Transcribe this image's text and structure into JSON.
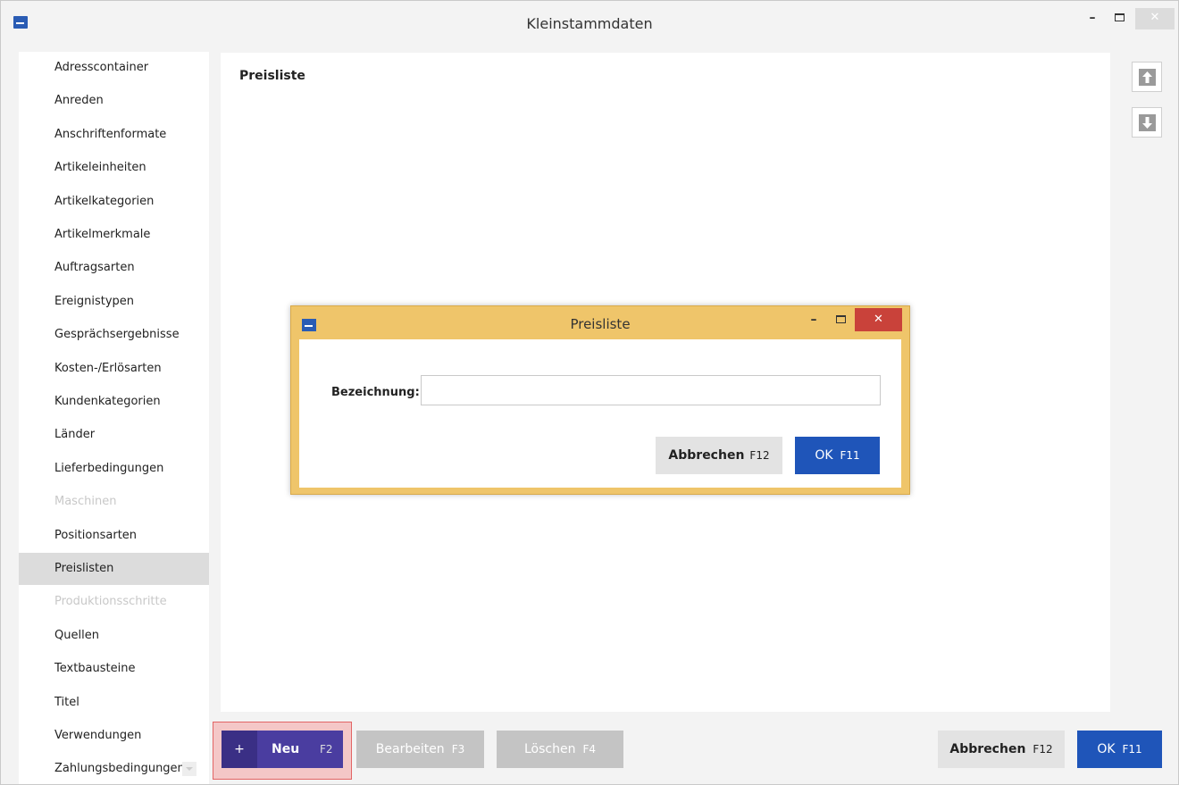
{
  "window": {
    "title": "Kleinstammdaten",
    "minimize": "–",
    "close": "✕"
  },
  "sidebar": {
    "items": [
      {
        "label": "Adresscontainer",
        "state": "normal"
      },
      {
        "label": "Anreden",
        "state": "normal"
      },
      {
        "label": "Anschriftenformate",
        "state": "normal"
      },
      {
        "label": "Artikeleinheiten",
        "state": "normal"
      },
      {
        "label": "Artikelkategorien",
        "state": "normal"
      },
      {
        "label": "Artikelmerkmale",
        "state": "normal"
      },
      {
        "label": "Auftragsarten",
        "state": "normal"
      },
      {
        "label": "Ereignistypen",
        "state": "normal"
      },
      {
        "label": "Gesprächsergebnisse",
        "state": "normal"
      },
      {
        "label": "Kosten-/Erlösarten",
        "state": "normal"
      },
      {
        "label": "Kundenkategorien",
        "state": "normal"
      },
      {
        "label": "Länder",
        "state": "normal"
      },
      {
        "label": "Lieferbedingungen",
        "state": "normal"
      },
      {
        "label": "Maschinen",
        "state": "disabled"
      },
      {
        "label": "Positionsarten",
        "state": "normal"
      },
      {
        "label": "Preislisten",
        "state": "selected"
      },
      {
        "label": "Produktionsschritte",
        "state": "disabled"
      },
      {
        "label": "Quellen",
        "state": "normal"
      },
      {
        "label": "Textbausteine",
        "state": "normal"
      },
      {
        "label": "Titel",
        "state": "normal"
      },
      {
        "label": "Verwendungen",
        "state": "normal"
      },
      {
        "label": "Zahlungsbedingungen",
        "state": "normal"
      }
    ]
  },
  "content": {
    "title": "Preisliste"
  },
  "toolbar": {
    "neu_plus": "+",
    "neu_label": "Neu",
    "neu_key": "F2",
    "bearbeiten_label": "Bearbeiten",
    "bearbeiten_key": "F3",
    "loeschen_label": "Löschen",
    "loeschen_key": "F4",
    "abbrechen_label": "Abbrechen",
    "abbrechen_key": "F12",
    "ok_label": "OK",
    "ok_key": "F11"
  },
  "dialog": {
    "title": "Preisliste",
    "minimize": "–",
    "close": "✕",
    "field_label": "Bezeichnung:",
    "field_value": "",
    "abbrechen_label": "Abbrechen",
    "abbrechen_key": "F12",
    "ok_label": "OK",
    "ok_key": "F11"
  },
  "colors": {
    "accent_blue": "#1f55b9",
    "neu_purple": "#4a3da0",
    "dialog_border": "#efc56a",
    "close_red": "#c9423a",
    "highlight_frame": "#e26464"
  }
}
